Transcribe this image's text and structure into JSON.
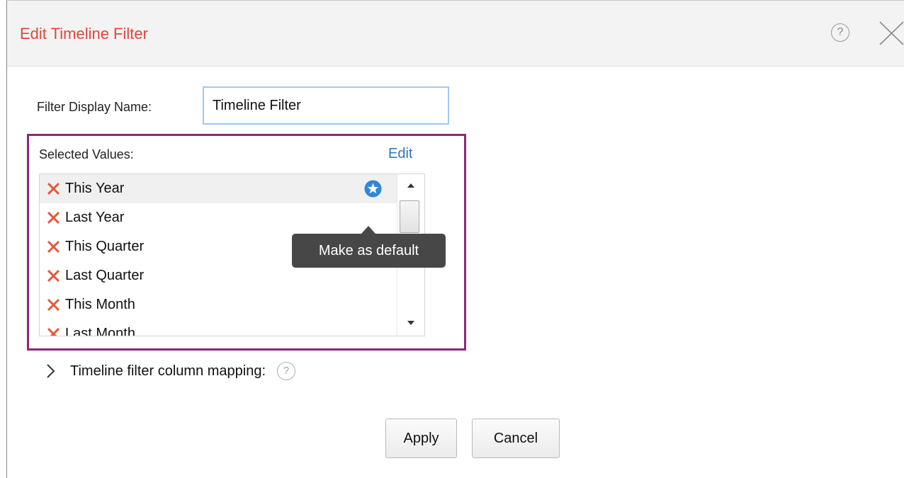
{
  "dialog": {
    "title": "Edit Timeline Filter",
    "help_icon": "question-circle-icon",
    "help_glyph": "?",
    "close_icon": "close-x-icon"
  },
  "filter_name": {
    "label": "Filter Display Name:",
    "value": "Timeline Filter"
  },
  "selected_values": {
    "label": "Selected Values:",
    "edit_label": "Edit",
    "items": [
      {
        "label": "This Year",
        "remove_icon": "remove-x-icon"
      },
      {
        "label": "Last Year",
        "remove_icon": "remove-x-icon"
      },
      {
        "label": "This Quarter",
        "remove_icon": "remove-x-icon"
      },
      {
        "label": "Last Quarter",
        "remove_icon": "remove-x-icon"
      },
      {
        "label": "This Month",
        "remove_icon": "remove-x-icon"
      },
      {
        "label": "Last Month",
        "remove_icon": "remove-x-icon"
      }
    ],
    "hovered_item": "This Year",
    "default_icon": "star-circle-icon",
    "tooltip": "Make as default"
  },
  "mapping": {
    "chevron_icon": "chevron-right-icon",
    "label": "Timeline filter column mapping:",
    "help_glyph": "?"
  },
  "buttons": {
    "apply": "Apply",
    "cancel": "Cancel"
  },
  "colors": {
    "title": "#e2453b",
    "highlight_border": "#8b2a78",
    "link": "#2f74c0",
    "remove_x": "#e35a3c",
    "star_badge": "#2f87d8",
    "tooltip_bg": "#474747"
  }
}
